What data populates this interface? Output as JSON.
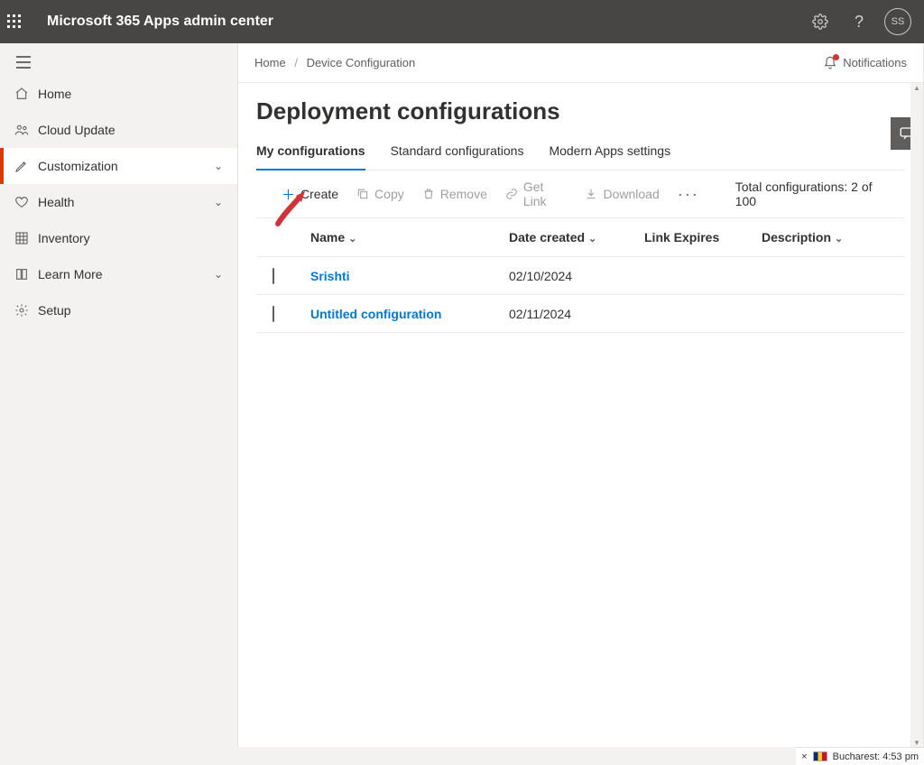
{
  "suite": {
    "title": "Microsoft 365 Apps admin center",
    "avatar_initials": "SS"
  },
  "nav": {
    "items": [
      {
        "label": "Home",
        "icon": "home"
      },
      {
        "label": "Cloud Update",
        "icon": "people"
      },
      {
        "label": "Customization",
        "icon": "pencil",
        "selected": true,
        "expandable": true
      },
      {
        "label": "Health",
        "icon": "heart",
        "expandable": true
      },
      {
        "label": "Inventory",
        "icon": "grid"
      },
      {
        "label": "Learn More",
        "icon": "book",
        "expandable": true
      },
      {
        "label": "Setup",
        "icon": "gear"
      }
    ]
  },
  "breadcrumb": {
    "root": "Home",
    "current": "Device Configuration"
  },
  "notifications_label": "Notifications",
  "page_title": "Deployment configurations",
  "tabs": [
    {
      "label": "My configurations",
      "active": true
    },
    {
      "label": "Standard configurations"
    },
    {
      "label": "Modern Apps settings"
    }
  ],
  "commands": {
    "create": "Create",
    "copy": "Copy",
    "remove": "Remove",
    "getlink": "Get Link",
    "download": "Download"
  },
  "totals_label": "Total configurations: 2 of 100",
  "columns": {
    "name": "Name",
    "date_created": "Date created",
    "link_expires": "Link Expires",
    "description": "Description"
  },
  "rows": [
    {
      "name": "Srishti",
      "date": "02/10/2024",
      "link_expires": "",
      "description": ""
    },
    {
      "name": "Untitled configuration",
      "date": "02/11/2024",
      "link_expires": "",
      "description": ""
    }
  ],
  "status": {
    "close": "×",
    "location": "Bucharest: 4:53 pm"
  }
}
